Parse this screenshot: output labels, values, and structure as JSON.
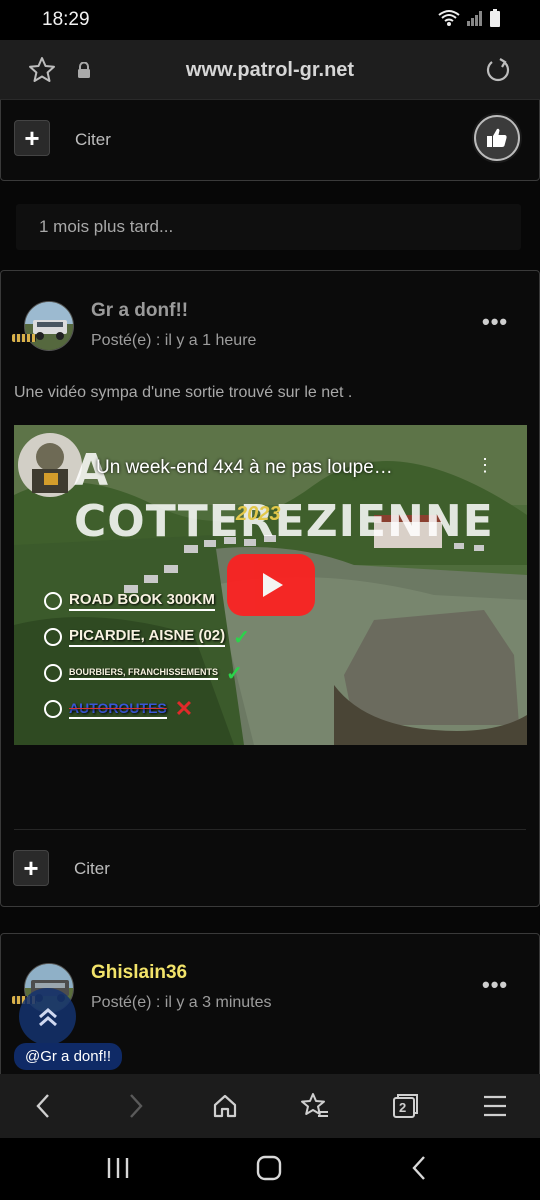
{
  "status_bar": {
    "time": "18:29"
  },
  "browser": {
    "url": "www.patrol-gr.net",
    "tab_count": "2"
  },
  "top_card": {
    "cite_label": "Citer"
  },
  "time_separator": {
    "text": "1 mois plus tard..."
  },
  "post1": {
    "author": "Gr a donf!!",
    "posted": "Posté(e) : il y a 1 heure",
    "body": "Une vidéo sympa d'une sortie trouvé sur le net .",
    "cite_label": "Citer",
    "video": {
      "title": "Un week-end 4x4 à ne pas loupe…",
      "big_title": "A COTTEREZIENNE",
      "year": "2023",
      "checklist": [
        {
          "text": "ROAD BOOK 300KM",
          "mark": ""
        },
        {
          "text": "PICARDIE, AISNE (02)",
          "mark": "✓"
        },
        {
          "text": "BOURBIERS, FRANCHISSEMENTS",
          "mark": "✓"
        },
        {
          "text": "AUTOROUTES",
          "mark": "✕"
        }
      ]
    }
  },
  "post2": {
    "author": "Ghislain36",
    "posted": "Posté(e) : il y a 3 minutes",
    "mention": "@Gr a donf!!"
  },
  "colors": {
    "accent_author": "#f2e36a",
    "youtube_red": "#ff1f1f",
    "mention_bg": "#0f2a66"
  }
}
